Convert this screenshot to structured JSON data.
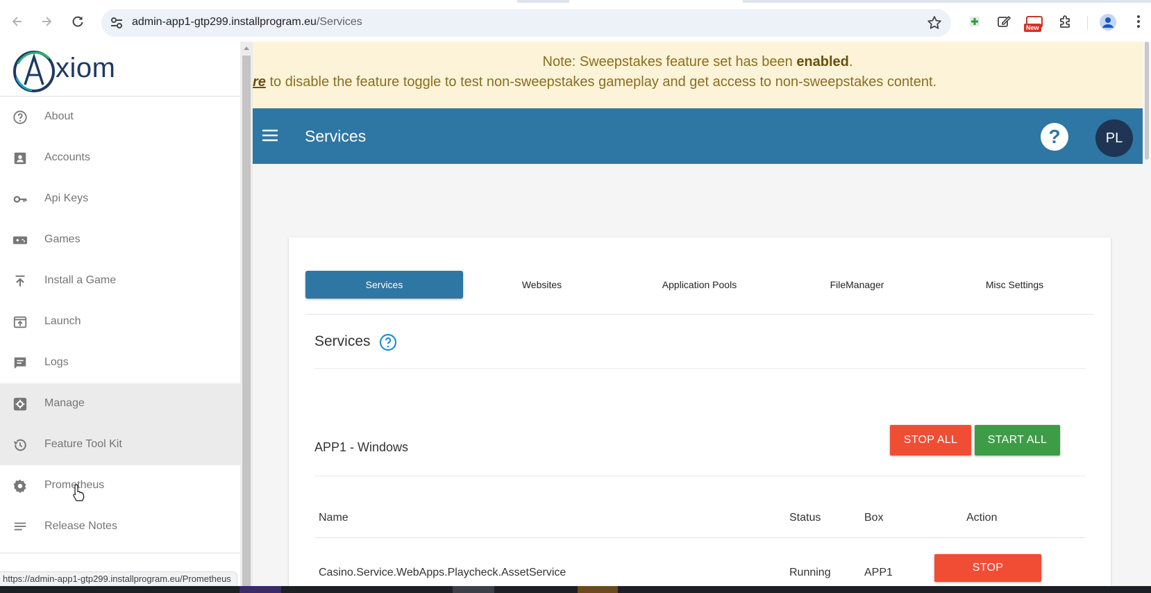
{
  "browser": {
    "url_host": "admin-app1-gtp299.installprogram.eu",
    "url_path": "/Services",
    "extension_badge": "New",
    "status_url": "https://admin-app1-gtp299.installprogram.eu/Prometheus"
  },
  "sidebar": {
    "logo_text": "xiom",
    "items": [
      {
        "label": "About",
        "icon": "help-circle-icon"
      },
      {
        "label": "Accounts",
        "icon": "account-box-icon"
      },
      {
        "label": "Api Keys",
        "icon": "key-icon"
      },
      {
        "label": "Games",
        "icon": "gamepad-icon"
      },
      {
        "label": "Install a Game",
        "icon": "upload-icon"
      },
      {
        "label": "Launch",
        "icon": "launch-icon"
      },
      {
        "label": "Logs",
        "icon": "message-icon"
      },
      {
        "label": "Manage",
        "icon": "settings-box-icon"
      },
      {
        "label": "Feature Tool Kit",
        "icon": "history-icon"
      },
      {
        "label": "Prometheus",
        "icon": "gear-icon"
      },
      {
        "label": "Release Notes",
        "icon": "notes-icon"
      }
    ]
  },
  "banner": {
    "line1_prefix": "Note: Sweepstakes feature set has been ",
    "line1_bold": "enabled",
    "line1_suffix": ".",
    "line2_link": "re",
    "line2_text": " to disable the feature toggle to test non-sweepstakes gameplay and get access to non-sweepstakes content."
  },
  "appbar": {
    "title": "Services",
    "help_label": "?",
    "user_initials": "PL"
  },
  "tabs": [
    "Services",
    "Websites",
    "Application Pools",
    "FileManager",
    "Misc Settings"
  ],
  "selected_tab": "Services",
  "section": {
    "title": "Services",
    "group_title": "APP1 - Windows",
    "stop_all_label": "STOP ALL",
    "start_all_label": "START ALL"
  },
  "table": {
    "headers": {
      "name": "Name",
      "status": "Status",
      "box": "Box",
      "action": "Action"
    },
    "rows": [
      {
        "name": "Casino.Service.WebApps.Playcheck.AssetService",
        "status": "Running",
        "box": "APP1",
        "action": "STOP"
      }
    ]
  },
  "colors": {
    "primary": "#2e76a3",
    "danger": "#f14d35",
    "success": "#3e9c47",
    "banner_bg": "#fdf3d8",
    "banner_text": "#8a6d1f",
    "avatar_bg": "#1f3553"
  }
}
